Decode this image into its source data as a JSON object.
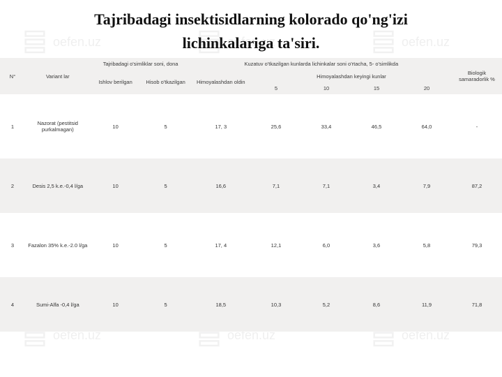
{
  "watermark_text": "oefen.uz",
  "title_line1": "Tajribadagi insektisidlarning kolorado qo'ng'izi",
  "title_line2": "lichinkalariga ta'siri.",
  "headers": {
    "no": "N°",
    "variant": "Variant\nlar",
    "tajriba": "Tajribadagi o'simliklar soni, dona",
    "ishlov": "Ishlov berilgan",
    "hisob": "Hisob o'tkazilgan",
    "kuzatuv": "Kuzatuv o'tkazilgan kunlarda lichinkalar soni o'rtacha, 5- o'simlikda",
    "oldin": "Himoyalashdan oldin",
    "keyingi": "Himoyalashdan keyingi kunlar",
    "d5": "5",
    "d10": "10",
    "d15": "15",
    "d20": "20",
    "bio": "Biologik samaradorlik\n%"
  },
  "rows": [
    {
      "no": "1",
      "variant": "Nazorat (pestitsid purkalmagan)",
      "ish": "10",
      "his": "5",
      "old": "17, 3",
      "d5": "25,6",
      "d10": "33,4",
      "d15": "46,5",
      "d20": "64,0",
      "bio": "-"
    },
    {
      "no": "2",
      "variant": "Desis 2,5 k.e.-0,4 l/ga",
      "ish": "10",
      "his": "5",
      "old": "16,6",
      "d5": "7,1",
      "d10": "7,1",
      "d15": "3,4",
      "d20": "7,9",
      "bio": "87,2"
    },
    {
      "no": "3",
      "variant": "Fazalon 35% k.e.-2.0 l/ga",
      "ish": "10",
      "his": "5",
      "old": "17, 4",
      "d5": "12,1",
      "d10": "6,0",
      "d15": "3,6",
      "d20": "5,8",
      "bio": "79,3"
    },
    {
      "no": "4",
      "variant": "Sumi-Alfa -0,4 l/ga",
      "ish": "10",
      "his": "5",
      "old": "18,5",
      "d5": "10,3",
      "d10": "5,2",
      "d15": "8,6",
      "d20": "11,9",
      "bio": "71,8"
    }
  ],
  "chart_data": {
    "type": "table",
    "title": "Tajribadagi insektisidlarning kolorado qo'ng'izi lichinkalariga ta'siri.",
    "columns": [
      "N°",
      "Variantlar",
      "Ishlov berilgan",
      "Hisob o'tkazilgan",
      "Himoyalashdan oldin",
      "5",
      "10",
      "15",
      "20",
      "Biologik samaradorlik %"
    ],
    "rows": [
      [
        "1",
        "Nazorat (pestitsid purkalmagan)",
        10,
        5,
        17.3,
        25.6,
        33.4,
        46.5,
        64.0,
        null
      ],
      [
        "2",
        "Desis 2,5 k.e.-0,4 l/ga",
        10,
        5,
        16.6,
        7.1,
        7.1,
        3.4,
        7.9,
        87.2
      ],
      [
        "3",
        "Fazalon 35% k.e.-2.0 l/ga",
        10,
        5,
        17.4,
        12.1,
        6.0,
        3.6,
        5.8,
        79.3
      ],
      [
        "4",
        "Sumi-Alfa -0,4 l/ga",
        10,
        5,
        18.5,
        10.3,
        5.2,
        8.6,
        11.9,
        71.8
      ]
    ]
  }
}
